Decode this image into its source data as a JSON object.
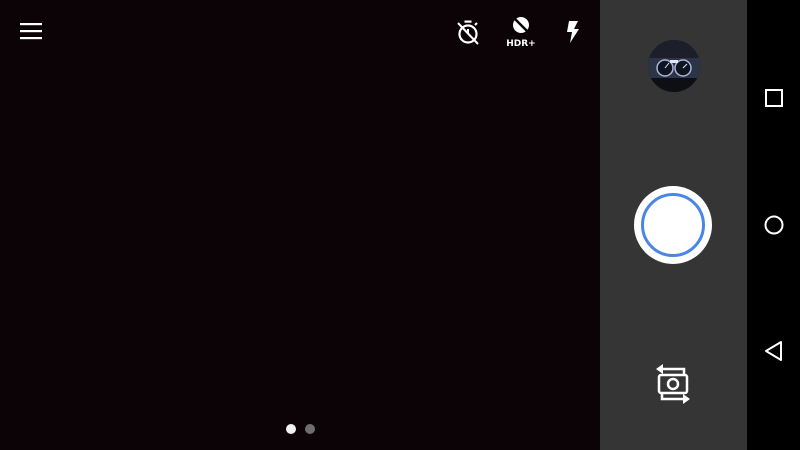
{
  "viewfinder": {
    "background": "#0b0306",
    "menu_icon": "hamburger-menu-icon",
    "top_controls": {
      "timer_icon": "timer-off-icon",
      "hdr_icon": "hdr-plus-icon",
      "hdr_label": "HDR+",
      "flash_icon": "flash-icon"
    },
    "mode_pages": {
      "count": 2,
      "active_index": 0
    }
  },
  "control_panel": {
    "background": "#353535",
    "thumbnail_icon": "last-photo-thumbnail",
    "shutter_icon": "shutter-icon",
    "shutter_ring_color": "#4a86e8",
    "switch_camera_icon": "switch-camera-icon"
  },
  "nav_bar": {
    "recents_icon": "recents-square-icon",
    "home_icon": "home-circle-icon",
    "back_icon": "back-triangle-icon"
  }
}
